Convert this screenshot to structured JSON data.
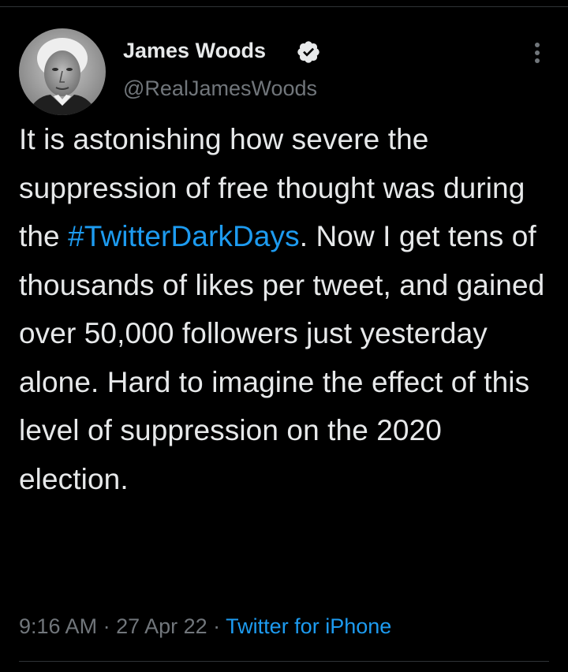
{
  "colors": {
    "background": "#000000",
    "text": "#e7e9ea",
    "secondary": "#71767b",
    "accent": "#1d9bf0",
    "divider": "#2f3336"
  },
  "author": {
    "name": "James Woods",
    "handle": "@RealJamesWoods",
    "verified": true,
    "verified_icon": "verified-badge-icon",
    "avatar_icon": "avatar-photo"
  },
  "more_icon": "more-vertical-icon",
  "tweet": {
    "text_before": "It is astonishing how severe the suppression of free thought was during the ",
    "hashtag": "#TwitterDarkDays",
    "text_after": ". Now I get tens of thousands of likes per tweet, and gained over 50,000 followers just yesterday alone. Hard to imagine the effect of this level of suppression on the 2020 election."
  },
  "meta": {
    "time": "9:16 AM",
    "separator": " · ",
    "date": "27 Apr 22",
    "source": "Twitter for iPhone"
  }
}
